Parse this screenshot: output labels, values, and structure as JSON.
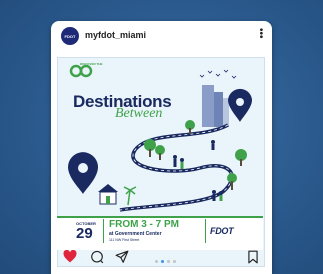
{
  "post": {
    "username": "myfdot_miami",
    "avatar_text": "FDOT"
  },
  "flyer": {
    "tagline": "DISCOVER THE",
    "title": "Destinations",
    "title_script": "Between",
    "month": "OCTOBER",
    "day": "29",
    "time": "FROM 3 - 7 PM",
    "place": "at Government Center",
    "address": "111 NW First Street",
    "logo": "FDOT"
  },
  "carousel": {
    "total": 4,
    "active_index": 1
  },
  "colors": {
    "background": "#2b5a8e",
    "navy": "#1a2a60",
    "green": "#3fa24a",
    "like_red": "#e0243b",
    "dot_active": "#3897f0"
  },
  "icons": [
    "heart-icon",
    "comment-icon",
    "share-icon",
    "bookmark-icon",
    "more-icon"
  ]
}
